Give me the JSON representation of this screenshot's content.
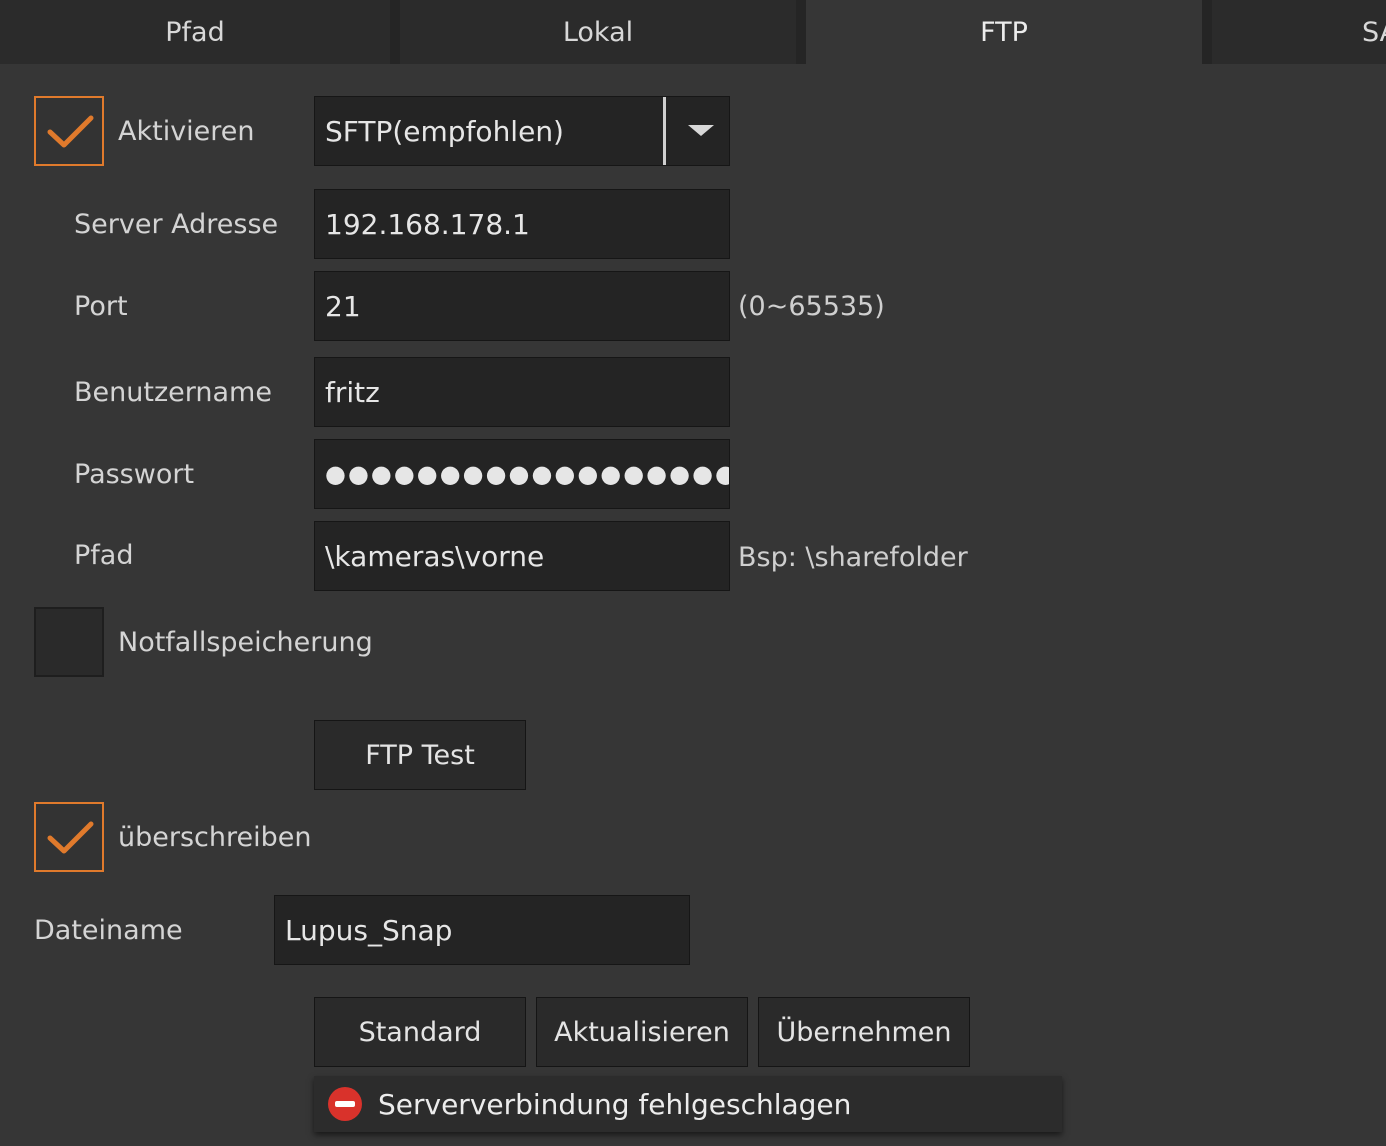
{
  "tabs": [
    {
      "label": "Pfad",
      "active": false
    },
    {
      "label": "Lokal",
      "active": false
    },
    {
      "label": "FTP",
      "active": true
    },
    {
      "label": "SA",
      "active": false
    }
  ],
  "enable": {
    "label": "Aktivieren",
    "checked": true
  },
  "protocol": {
    "value": "SFTP(empfohlen)"
  },
  "server": {
    "label": "Server Adresse",
    "value": "192.168.178.1"
  },
  "port": {
    "label": "Port",
    "value": "21",
    "hint": "(0~65535)"
  },
  "username": {
    "label": "Benutzername",
    "value": "fritz"
  },
  "password": {
    "label": "Passwort",
    "value": "●●●●●●●●●●●●●●●●●●●●"
  },
  "path": {
    "label": "Pfad",
    "value": "\\kameras\\vorne",
    "hint": "Bsp: \\sharefolder"
  },
  "emergency": {
    "label": "Notfallspeicherung",
    "checked": false
  },
  "ftp_test": {
    "label": "FTP Test"
  },
  "overwrite": {
    "label": "überschreiben",
    "checked": true
  },
  "filename": {
    "label": "Dateiname",
    "value": "Lupus_Snap"
  },
  "actions": {
    "standard": "Standard",
    "refresh": "Aktualisieren",
    "apply": "Übernehmen"
  },
  "toast": {
    "message": "Serververbindung fehlgeschlagen",
    "icon": "error-icon"
  },
  "colors": {
    "accent": "#e07a2c",
    "background": "#363636",
    "field": "#242424",
    "error": "#d9322b"
  }
}
